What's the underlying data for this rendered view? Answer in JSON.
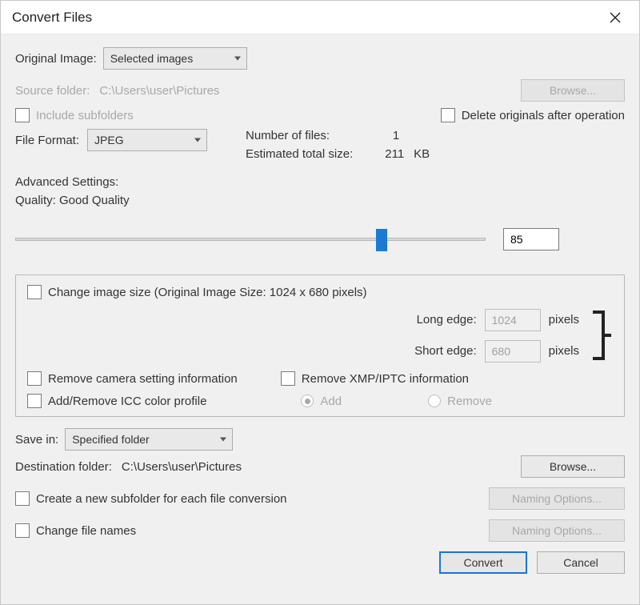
{
  "title": "Convert Files",
  "originalImage": {
    "label": "Original Image:",
    "value": "Selected images"
  },
  "sourceFolder": {
    "label": "Source folder:",
    "path": "C:\\Users\\user\\Pictures"
  },
  "browse": "Browse...",
  "includeSubfolders": "Include subfolders",
  "deleteOriginals": "Delete originals after operation",
  "fileFormat": {
    "label": "File Format:",
    "value": "JPEG"
  },
  "stats": {
    "numFilesLabel": "Number of files:",
    "numFiles": "1",
    "estSizeLabel": "Estimated total size:",
    "estSize": "211",
    "estSizeUnit": "KB"
  },
  "advanced": {
    "heading": "Advanced Settings:",
    "qualityLine": "Quality: Good Quality",
    "qualityValue": "85",
    "qualityPct": 78
  },
  "size": {
    "checkboxLabel": "Change image size (Original Image Size: 1024 x 680 pixels)",
    "longEdgeLabel": "Long edge:",
    "longEdge": "1024",
    "shortEdgeLabel": "Short edge:",
    "shortEdge": "680",
    "unit": "pixels"
  },
  "removeCamera": "Remove camera setting information",
  "removeXmp": "Remove XMP/IPTC information",
  "iccProfile": "Add/Remove ICC color profile",
  "iccAdd": "Add",
  "iccRemove": "Remove",
  "saveIn": {
    "label": "Save in:",
    "value": "Specified folder"
  },
  "destFolder": {
    "label": "Destination folder:",
    "path": "C:\\Users\\user\\Pictures"
  },
  "createSubfolder": "Create a new subfolder for each file conversion",
  "changeFileNames": "Change file names",
  "namingOptions": "Naming Options...",
  "convert": "Convert",
  "cancel": "Cancel"
}
